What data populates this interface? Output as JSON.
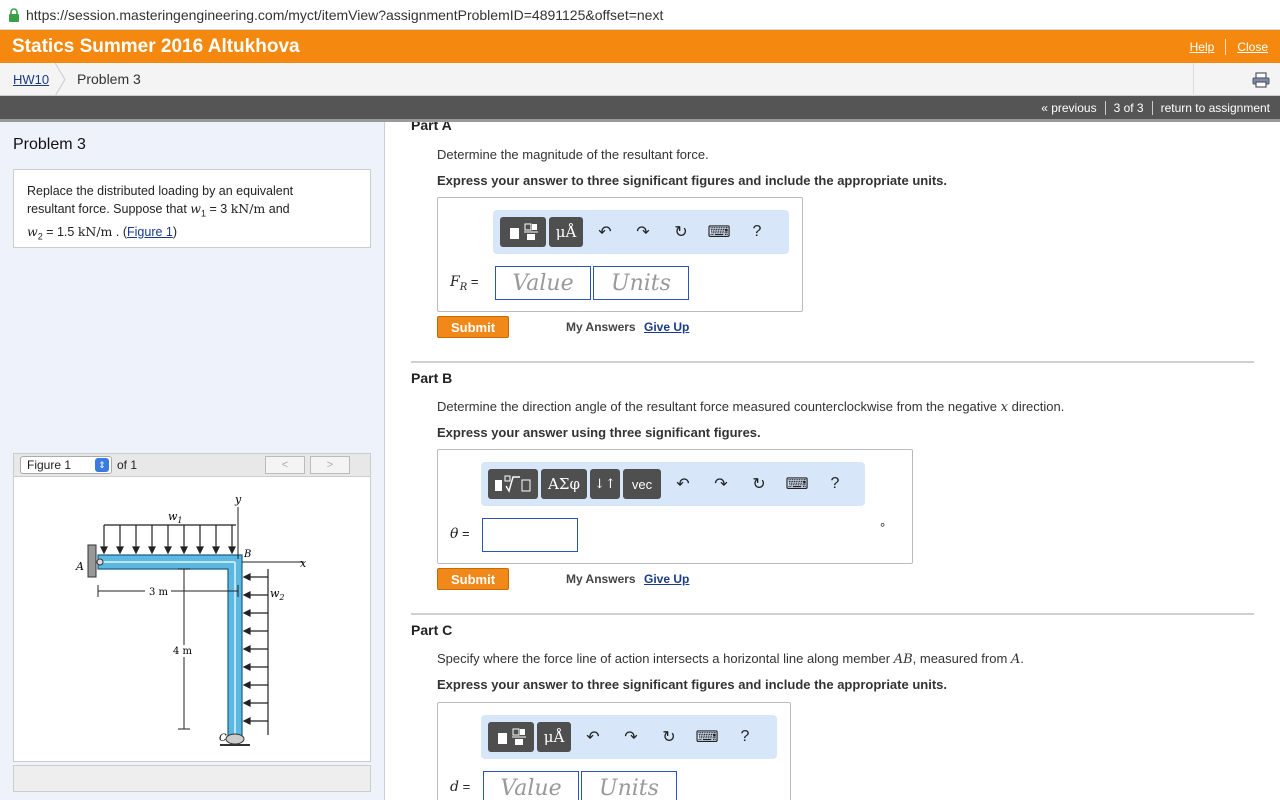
{
  "browser": {
    "url": "https://session.masteringengineering.com/myct/itemView?assignmentProblemID=4891125&offset=next"
  },
  "header": {
    "course_title": "Statics Summer 2016 Altukhova",
    "help_label": "Help",
    "close_label": "Close"
  },
  "breadcrumb": {
    "assignment": "HW10",
    "problem": "Problem 3"
  },
  "nav": {
    "previous": "« previous",
    "position": "3 of 3",
    "return": "return to assignment"
  },
  "problem": {
    "title": "Problem 3",
    "statement_1": "Replace the distributed loading by an equivalent",
    "statement_2a": "resultant force. Suppose that ",
    "w1_sym": "w",
    "w1_sub": "1",
    "w1_eq": " = 3  ",
    "unit": "kN/m",
    "statement_2b": " and",
    "w2_sym": "w",
    "w2_sub": "2",
    "w2_eq": " = 1.5  ",
    "statement_3b": " . (",
    "figure_link": "Figure 1",
    "statement_3c": ")"
  },
  "figure": {
    "selector": "Figure 1",
    "of_label": "of 1",
    "prev": "<",
    "next": ">",
    "labels": {
      "w1": "w",
      "w1sub": "1",
      "w2": "w",
      "w2sub": "2",
      "y": "y",
      "x": "x",
      "A": "A",
      "B": "B",
      "C": "C",
      "len_ab": "3 m",
      "len_bc": "4 m"
    }
  },
  "partA": {
    "label": "Part A",
    "question": "Determine the magnitude of the resultant force.",
    "instruction": "Express your answer to three significant figures and include the appropriate units.",
    "var": "F",
    "var_sub": "R",
    "eq": " =",
    "value_placeholder": "Value",
    "units_placeholder": "Units",
    "submit": "Submit",
    "my_answers": "My Answers",
    "give_up": "Give Up"
  },
  "partB": {
    "label": "Part B",
    "question_pre": "Determine the direction angle of the resultant force measured counterclockwise from the negative ",
    "question_var": "x",
    "question_post": " direction.",
    "instruction": "Express your answer using three significant figures.",
    "var": "θ",
    "eq": " =",
    "unit_symbol": "°",
    "greek_btn": "ΑΣφ",
    "sort_btn": "↓↑",
    "vec_btn": "vec",
    "submit": "Submit",
    "my_answers": "My Answers",
    "give_up": "Give Up"
  },
  "partC": {
    "label": "Part C",
    "question_pre": "Specify where the force line of action intersects a horizontal line along member ",
    "question_var1": "AB",
    "question_mid": ", measured from ",
    "question_var2": "A",
    "question_post": ".",
    "instruction": "Express your answer to three significant figures and include the appropriate units.",
    "var": "d",
    "eq": " =",
    "value_placeholder": "Value",
    "units_placeholder": "Units"
  },
  "toolbar": {
    "units_btn": "μÅ",
    "help": "?"
  },
  "colors": {
    "header": "#f5890f",
    "submit": "#f0891a",
    "toolbar_bg": "#d8e6fa",
    "link": "#1a3b87",
    "beam": "#5bb8e0"
  }
}
